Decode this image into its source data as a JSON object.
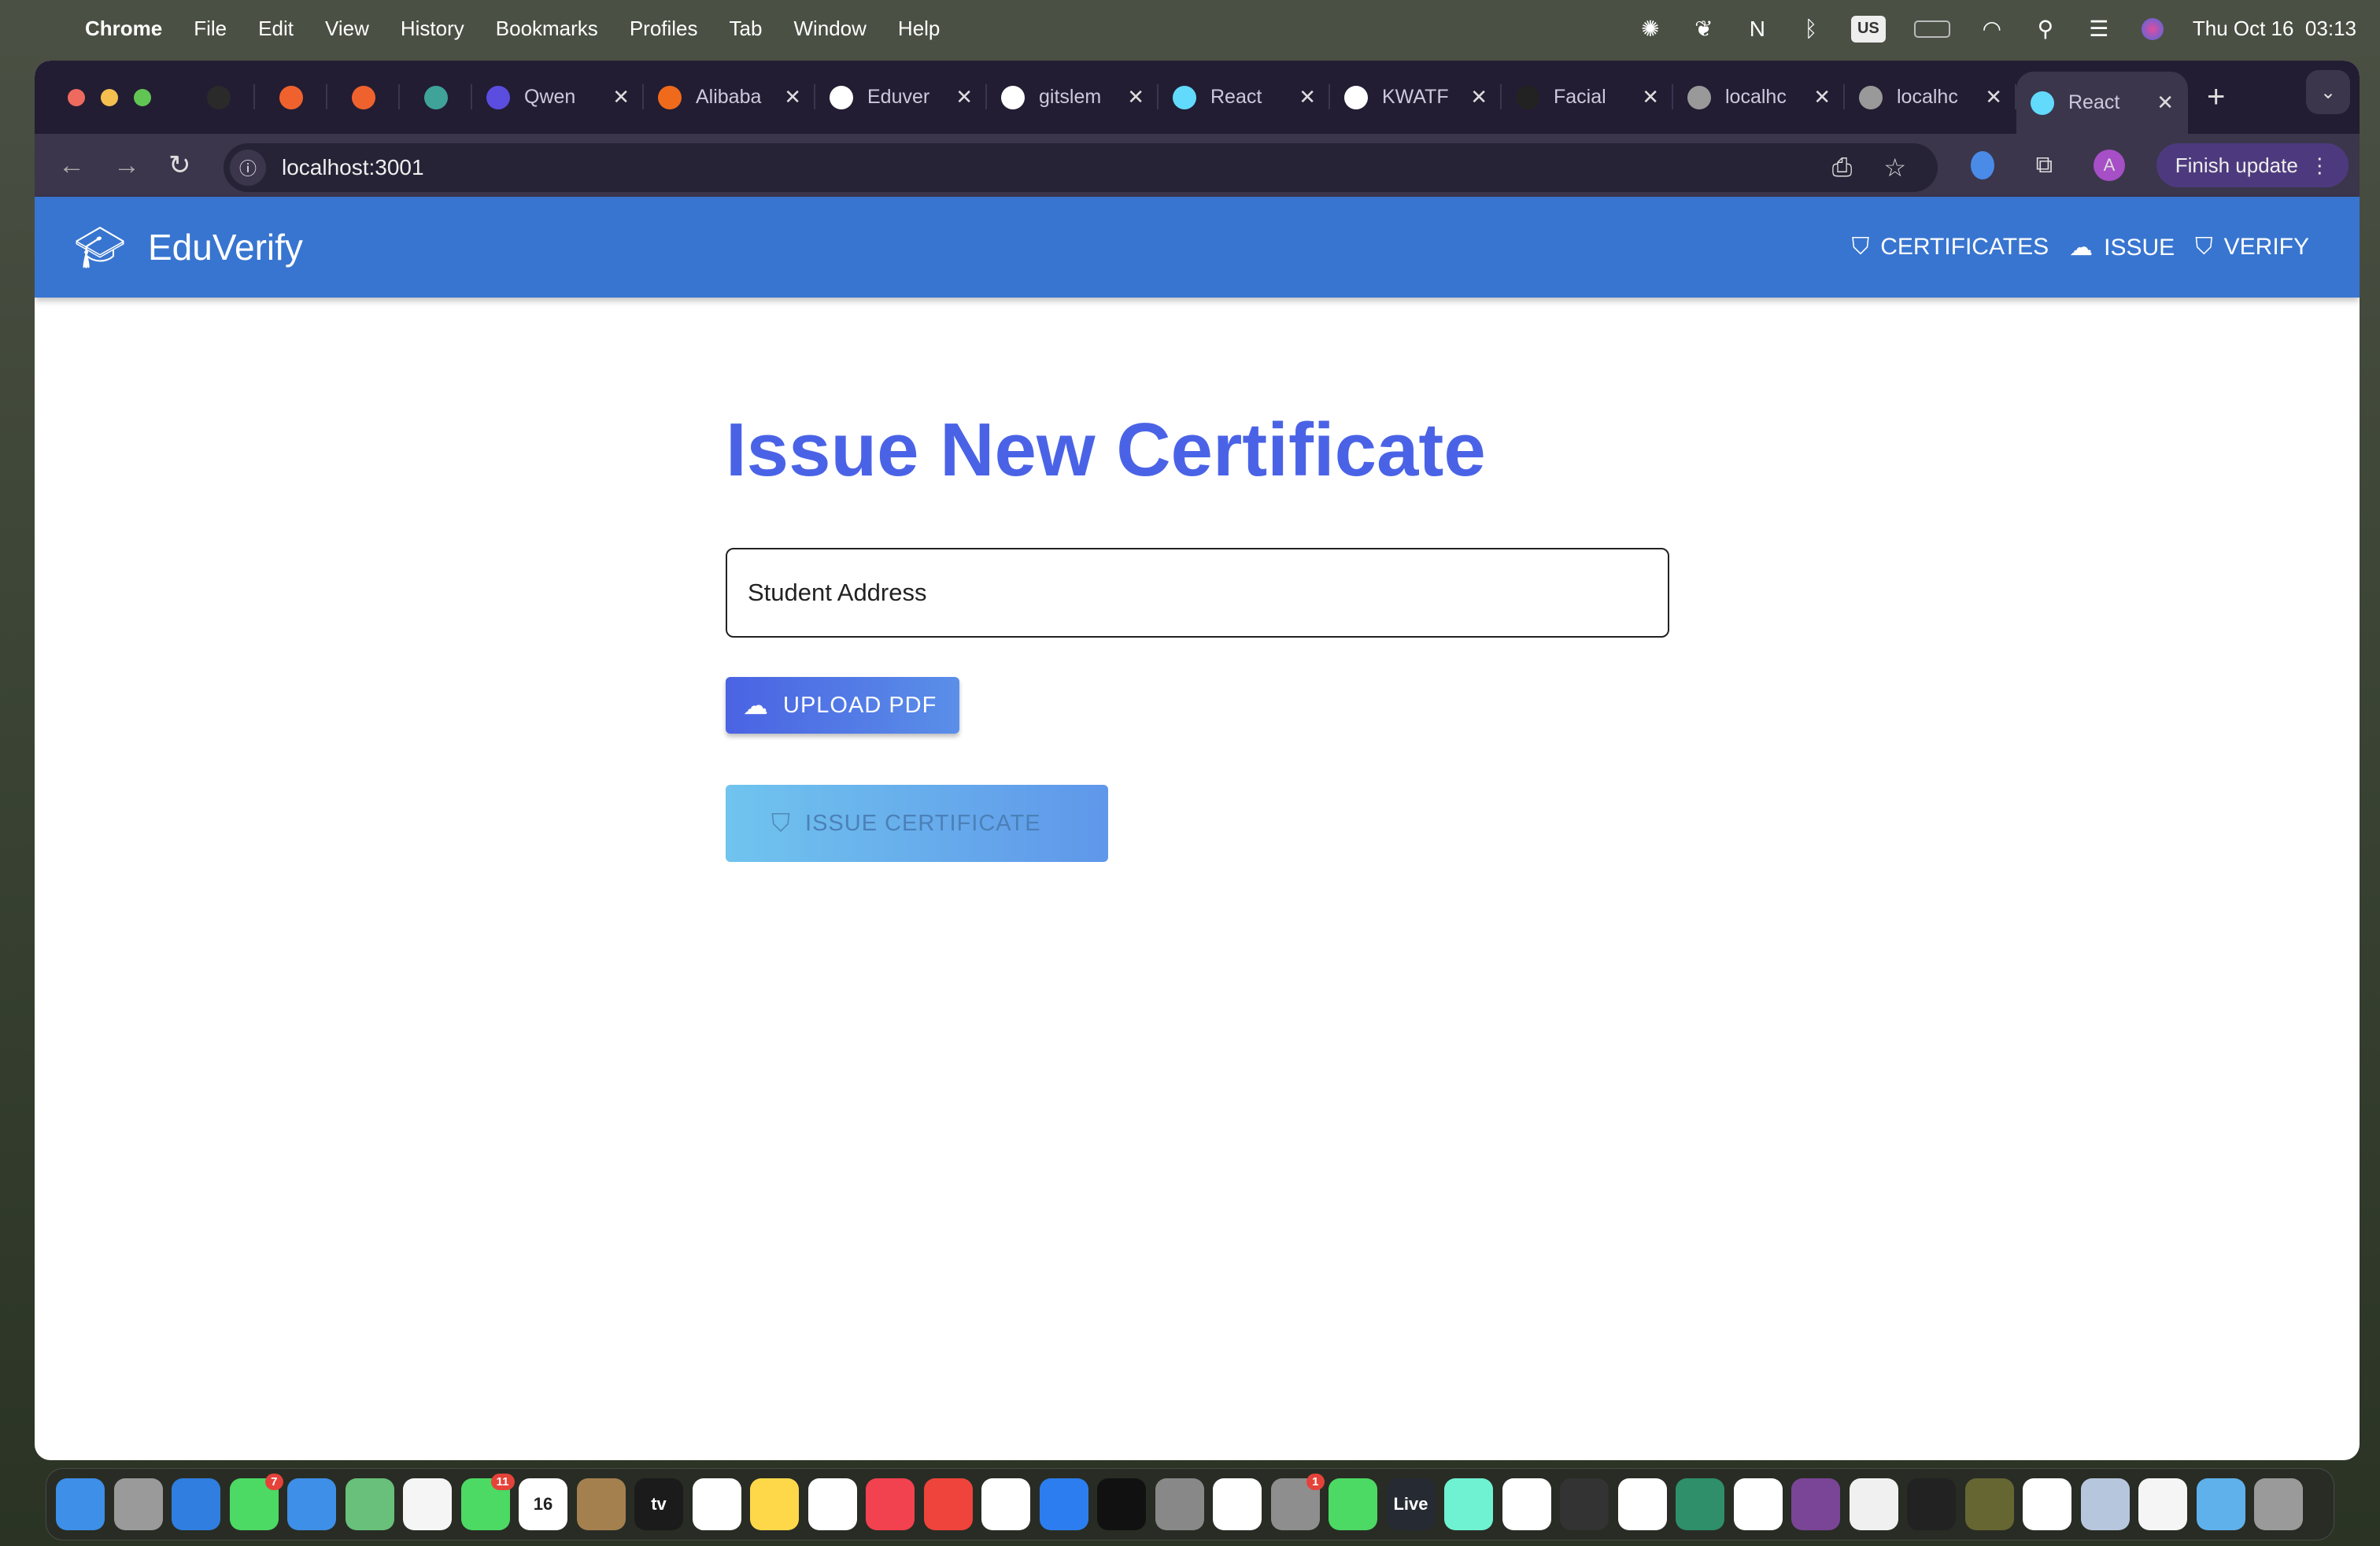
{
  "menubar": {
    "app": "Chrome",
    "items": [
      "File",
      "Edit",
      "View",
      "History",
      "Bookmarks",
      "Profiles",
      "Tab",
      "Window",
      "Help"
    ],
    "status_icons": [
      "chatgpt-icon",
      "docker-icon",
      "notion-icon",
      "bluetooth-icon",
      "keyboard-us-icon",
      "battery-icon",
      "wifi-icon",
      "search-icon",
      "control-center-icon",
      "siri-icon"
    ],
    "keyboard": "US",
    "clock": "Thu Oct 16  03:13"
  },
  "browser": {
    "tabs": [
      {
        "pinned": true,
        "icon": "github-icon",
        "color": "#2a2a2a"
      },
      {
        "pinned": true,
        "icon": "firebase-icon",
        "color": "#f0622d"
      },
      {
        "pinned": true,
        "icon": "firebase-icon",
        "color": "#f0622d"
      },
      {
        "pinned": true,
        "icon": "diamond-icon",
        "color": "#3fa39a"
      },
      {
        "title": "Qwen",
        "icon": "qwen-icon",
        "color": "#5b4de0"
      },
      {
        "title": "Alibaba",
        "icon": "alibaba-icon",
        "color": "#f06a1b"
      },
      {
        "title": "Eduver",
        "icon": "github-icon",
        "color": "#ffffff"
      },
      {
        "title": "gitslem",
        "icon": "github-icon",
        "color": "#ffffff"
      },
      {
        "title": "React",
        "icon": "react-icon",
        "color": "#61dafb"
      },
      {
        "title": "KWATF",
        "icon": "github-icon",
        "color": "#ffffff"
      },
      {
        "title": "Facial",
        "icon": "exclamation-icon",
        "color": "#222222"
      },
      {
        "title": "localhc",
        "icon": "globe-icon",
        "color": "#999999"
      },
      {
        "title": "localhc",
        "icon": "globe-icon",
        "color": "#999999"
      },
      {
        "title": "React",
        "icon": "react-icon",
        "color": "#61dafb",
        "active": true
      }
    ],
    "url": "localhost:3001",
    "profile_initial": "A",
    "finish_update": "Finish update"
  },
  "app": {
    "brand": "EduVerify",
    "nav": [
      {
        "label": "CERTIFICATES",
        "icon": "shield-check-icon"
      },
      {
        "label": "ISSUE",
        "icon": "cloud-upload-icon"
      },
      {
        "label": "VERIFY",
        "icon": "shield-check-icon"
      }
    ],
    "title": "Issue New Certificate",
    "address_placeholder": "Student Address",
    "upload_label": "UPLOAD PDF",
    "issue_label": "ISSUE CERTIFICATE",
    "colors": {
      "header": "#3875d0",
      "title": "#4a63e6",
      "upload": "#4a63e3",
      "issue_disabled": "#70c4ee"
    }
  },
  "dock": [
    {
      "name": "finder",
      "color": "#3d8fe8"
    },
    {
      "name": "launchpad",
      "color": "#9a9a9a"
    },
    {
      "name": "safari",
      "color": "#2f7ee0"
    },
    {
      "name": "messages",
      "color": "#4cd964",
      "badge": "7"
    },
    {
      "name": "mail",
      "color": "#3d8fe8"
    },
    {
      "name": "maps",
      "color": "#68c07a"
    },
    {
      "name": "photos",
      "color": "#f5f5f5"
    },
    {
      "name": "facetime",
      "color": "#4cd964",
      "badge": "11"
    },
    {
      "name": "calendar",
      "color": "#ffffff",
      "text": "16"
    },
    {
      "name": "contacts",
      "color": "#a5804f"
    },
    {
      "name": "apple-tv",
      "color": "#1b1b1b",
      "text": "tv"
    },
    {
      "name": "reminders",
      "color": "#ffffff"
    },
    {
      "name": "notes",
      "color": "#ffd84a"
    },
    {
      "name": "freeform",
      "color": "#ffffff"
    },
    {
      "name": "music",
      "color": "#f2414f"
    },
    {
      "name": "anydesk",
      "color": "#ef443b"
    },
    {
      "name": "news",
      "color": "#ffffff"
    },
    {
      "name": "app-store",
      "color": "#2c7ef0"
    },
    {
      "name": "terminal",
      "color": "#111111"
    },
    {
      "name": "preview",
      "color": "#888888"
    },
    {
      "name": "vscode",
      "color": "#ffffff"
    },
    {
      "name": "system-settings",
      "color": "#8e8e8e",
      "badge": "1"
    },
    {
      "name": "whatsapp",
      "color": "#4cd964"
    },
    {
      "name": "live",
      "color": "#262a33",
      "text": "Live"
    },
    {
      "name": "activity",
      "color": "#6ef2d2"
    },
    {
      "name": "capcut",
      "color": "#ffffff"
    },
    {
      "name": "quicktime",
      "color": "#333333"
    },
    {
      "name": "chrome",
      "color": "#ffffff"
    },
    {
      "name": "infinity",
      "color": "#2e8f6a"
    },
    {
      "name": "photo-app",
      "color": "#ffffff"
    },
    {
      "name": "business",
      "color": "#7a4497"
    },
    {
      "name": "chatgpt",
      "color": "#f0f0f0"
    },
    {
      "name": "ring-app",
      "color": "#222222"
    },
    {
      "name": "cocktail",
      "color": "#666633"
    },
    {
      "name": "notion",
      "color": "#ffffff"
    },
    {
      "name": "app-1",
      "color": "#b6c6dd"
    },
    {
      "name": "textedit",
      "color": "#f5f5f5"
    },
    {
      "name": "downloads-folder",
      "color": "#5fb1ec"
    },
    {
      "name": "trash",
      "color": "#9a9a9a"
    }
  ]
}
